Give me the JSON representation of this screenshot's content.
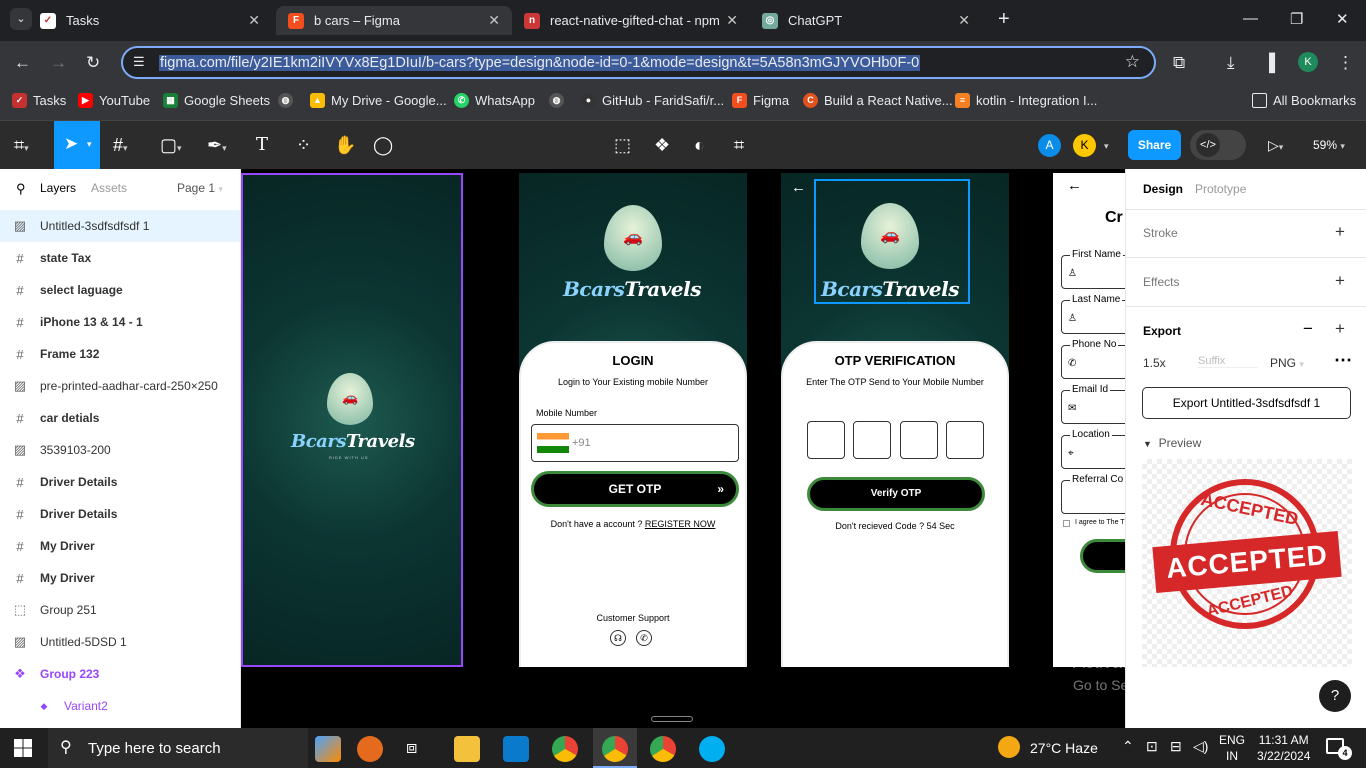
{
  "tabs": [
    {
      "title": "Tasks",
      "icon": "tasks-icon"
    },
    {
      "title": "b cars – Figma",
      "icon": "figma-icon"
    },
    {
      "title": "react-native-gifted-chat - npm",
      "icon": "npm-icon"
    },
    {
      "title": "ChatGPT",
      "icon": "chatgpt-icon"
    }
  ],
  "address": {
    "url": "figma.com/file/y2IE1km2iIVYVx8Eg1DIuI/b-cars?type=design&node-id=0-1&mode=design&t=5A58n3mGJYVOHb0F-0"
  },
  "bookmarks": [
    {
      "label": "Tasks",
      "color": "#c53030"
    },
    {
      "label": "YouTube",
      "color": "#ff0000"
    },
    {
      "label": "Google Sheets",
      "color": "#188038"
    },
    {
      "label": "",
      "color": "#555555"
    },
    {
      "label": "My Drive - Google...",
      "color": "#fbbc04"
    },
    {
      "label": "WhatsApp",
      "color": "#25d366"
    },
    {
      "label": "",
      "color": "#555555"
    },
    {
      "label": "GitHub - FaridSafi/r...",
      "color": "#333333"
    },
    {
      "label": "Figma",
      "color": "#f24e1e"
    },
    {
      "label": "Build a React Native...",
      "color": "#e0531f"
    },
    {
      "label": "kotlin - Integration I...",
      "color": "#f48024"
    }
  ],
  "all_bookmarks": "All Bookmarks",
  "figma_toolbar": {
    "share": "Share",
    "zoom": "59%",
    "avatar_a": "A",
    "avatar_k": "K"
  },
  "left_panel": {
    "tab_layers": "Layers",
    "tab_assets": "Assets",
    "page": "Page 1",
    "layers": [
      {
        "name": "Untitled-3sdfsdfsdf 1",
        "icon": "image-icon",
        "selected": true,
        "bold": false
      },
      {
        "name": "state Tax",
        "icon": "frame-icon",
        "bold": true
      },
      {
        "name": "select laguage",
        "icon": "frame-icon",
        "bold": true
      },
      {
        "name": "iPhone 13 & 14 - 1",
        "icon": "frame-icon",
        "bold": true
      },
      {
        "name": "Frame 132",
        "icon": "frame-icon",
        "bold": true
      },
      {
        "name": "pre-printed-aadhar-card-250×250",
        "icon": "image-icon",
        "bold": false
      },
      {
        "name": "car detials",
        "icon": "frame-icon",
        "bold": true
      },
      {
        "name": "3539103-200",
        "icon": "image-icon",
        "bold": false
      },
      {
        "name": "Driver Details",
        "icon": "frame-icon",
        "bold": true
      },
      {
        "name": "Driver Details",
        "icon": "frame-icon",
        "bold": true
      },
      {
        "name": "My Driver",
        "icon": "frame-icon",
        "bold": true
      },
      {
        "name": "My Driver",
        "icon": "frame-icon",
        "bold": true
      },
      {
        "name": "Group 251",
        "icon": "group-icon",
        "bold": false
      },
      {
        "name": "Untitled-5DSD 1",
        "icon": "image-icon",
        "bold": false
      },
      {
        "name": "Group 223",
        "icon": "component-icon",
        "bold": true,
        "purple": true
      },
      {
        "name": "Variant2",
        "icon": "variant-icon",
        "bold": false,
        "purple": true,
        "indent": true
      }
    ]
  },
  "canvas": {
    "brand_main": "Bcars",
    "brand_accent": "Travels",
    "tagline": "RIDE WITH US",
    "login": {
      "title": "LOGIN",
      "subtitle": "Login to Your Existing mobile Number",
      "mobile_label": "Mobile Number",
      "country_code": "+91",
      "button": "GET OTP",
      "register_prefix": "Don't have a  account ?",
      "register_link": "REGISTER NOW",
      "support": "Customer Support"
    },
    "otp": {
      "title": "OTP VERIFICATION",
      "subtitle": "Enter The OTP Send to Your Mobile Number",
      "button": "Verify OTP",
      "resend": "Don't recieved Code ? 54 Sec"
    },
    "create": {
      "title": "Cr",
      "fields": [
        "First Name",
        "Last Name",
        "Phone No",
        "Email Id",
        "Location",
        "Referral Co"
      ],
      "agree": "I agree to The T"
    }
  },
  "right_panel": {
    "tab_design": "Design",
    "tab_prototype": "Prototype",
    "stroke": "Stroke",
    "effects": "Effects",
    "export": "Export",
    "scale": "1.5x",
    "suffix_placeholder": "Suffix",
    "format": "PNG",
    "export_button": "Export Untitled-3sdfsdfsdf 1",
    "preview": "Preview",
    "stamp_top": "ACCEPTED",
    "stamp_mid": "ACCEPTED",
    "stamp_bottom": "ACCEPTED"
  },
  "watermark": {
    "line1": "Activate Windows",
    "line2": "Go to Settings to activate Windows."
  },
  "taskbar": {
    "search": "Type here to search",
    "weather": "27°C  Haze",
    "lang1": "ENG",
    "lang2": "IN",
    "time": "11:31 AM",
    "date": "3/22/2024",
    "notif": "4"
  }
}
